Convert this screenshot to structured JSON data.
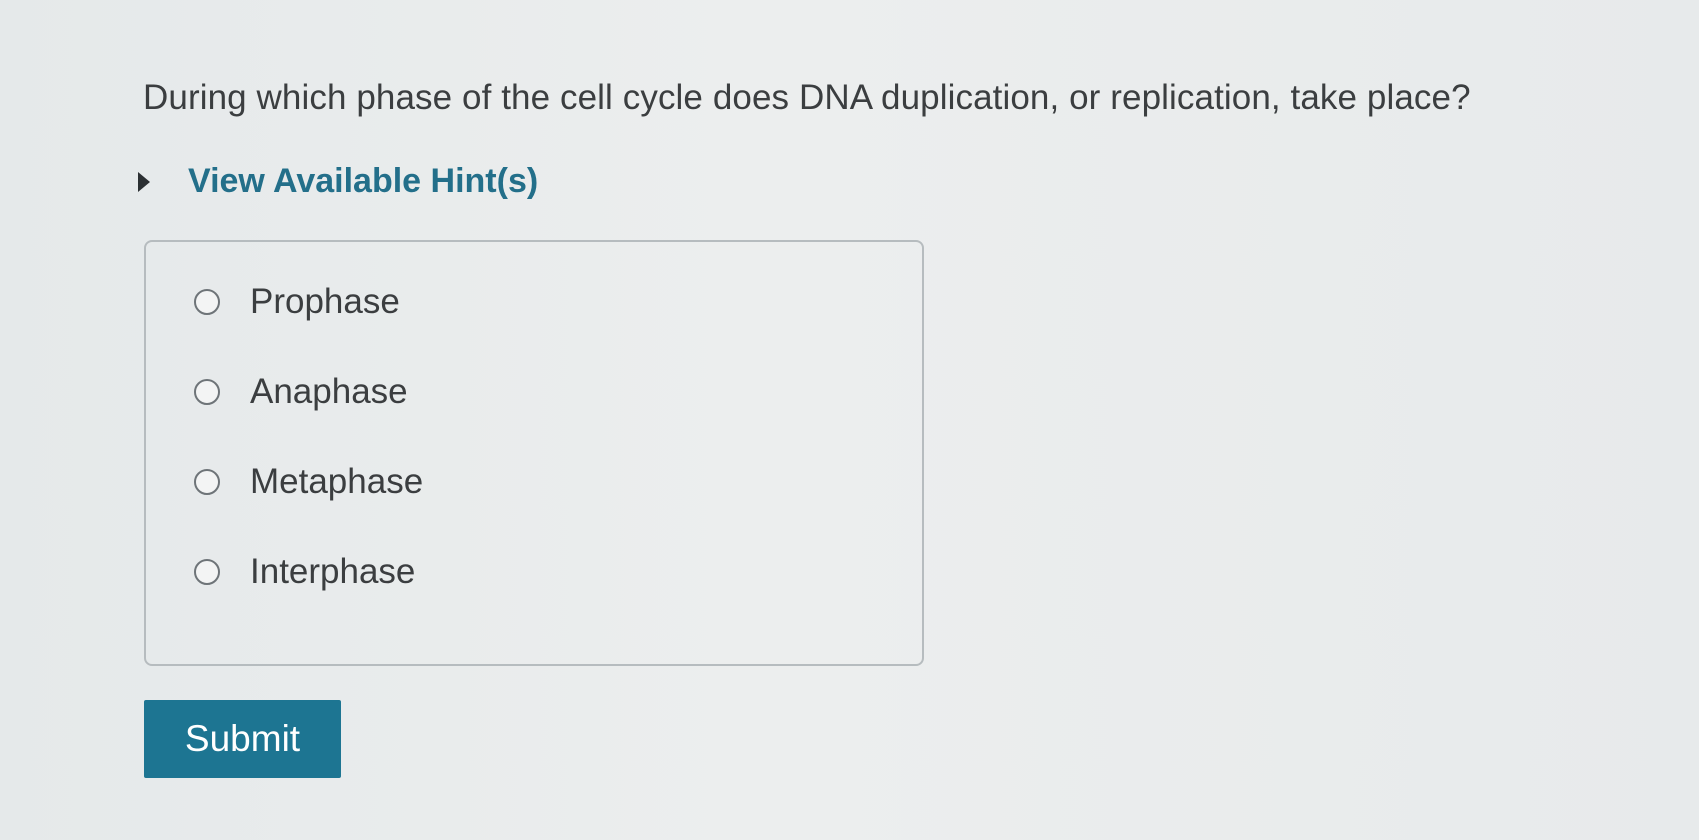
{
  "question": {
    "text": "During which phase of the cell cycle does DNA duplication, or replication, take place?"
  },
  "hints": {
    "toggle_label": "View Available Hint(s)"
  },
  "options": [
    {
      "label": "Prophase",
      "selected": false
    },
    {
      "label": "Anaphase",
      "selected": false
    },
    {
      "label": "Metaphase",
      "selected": false
    },
    {
      "label": "Interphase",
      "selected": false
    }
  ],
  "submit": {
    "label": "Submit"
  },
  "colors": {
    "accent": "#1d7592",
    "hint_text": "#236f8a"
  }
}
